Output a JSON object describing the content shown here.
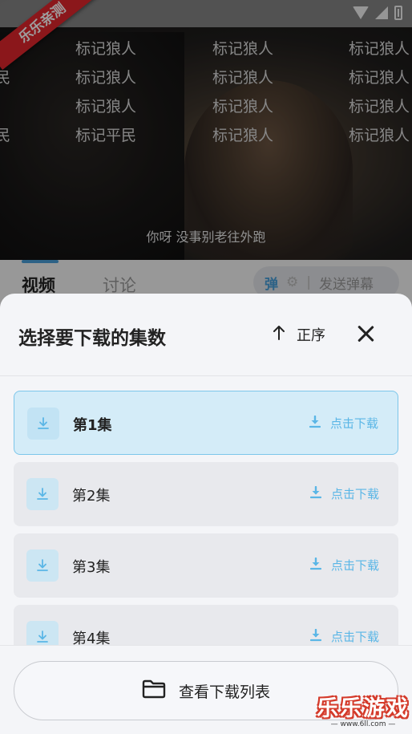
{
  "video": {
    "corner_badge": "乐乐亲测",
    "danmaku": [
      {
        "text": "标记狼人",
        "col": 1,
        "row": 0
      },
      {
        "text": "标记狼人",
        "col": 2,
        "row": 0
      },
      {
        "text": "标记狼人",
        "col": 3,
        "row": 0
      },
      {
        "text": "民",
        "col": 0,
        "row": 1
      },
      {
        "text": "标记狼人",
        "col": 1,
        "row": 1
      },
      {
        "text": "标记狼人",
        "col": 2,
        "row": 1
      },
      {
        "text": "标记狼人",
        "col": 3,
        "row": 1
      },
      {
        "text": "标记狼人",
        "col": 1,
        "row": 2
      },
      {
        "text": "标记狼人",
        "col": 2,
        "row": 2
      },
      {
        "text": "标记狼人",
        "col": 3,
        "row": 2
      },
      {
        "text": "民",
        "col": 0,
        "row": 3
      },
      {
        "text": "标记平民",
        "col": 1,
        "row": 3
      },
      {
        "text": "标记狼人",
        "col": 2,
        "row": 3
      },
      {
        "text": "标记狼人",
        "col": 3,
        "row": 3
      }
    ],
    "subtitle": "你呀 没事别老往外跑"
  },
  "tabs": {
    "video": "视频",
    "discuss": "讨论",
    "danmaku_toggle": "弹",
    "danmaku_settings": "⚙",
    "send_danmaku": "发送弹幕"
  },
  "sheet": {
    "title": "选择要下载的集数",
    "sort_label": "正序",
    "episodes": [
      {
        "name": "第1集",
        "action": "点击下载",
        "selected": true
      },
      {
        "name": "第2集",
        "action": "点击下载",
        "selected": false
      },
      {
        "name": "第3集",
        "action": "点击下载",
        "selected": false
      },
      {
        "name": "第4集",
        "action": "点击下载",
        "selected": false
      }
    ],
    "view_list_label": "查看下载列表"
  },
  "watermark": {
    "title": "乐乐游戏",
    "url": "— www.6ll.com —"
  },
  "colors": {
    "accent": "#5ab6e6",
    "selected_bg": "#d4ecf8",
    "badge_red": "#e1262d"
  }
}
